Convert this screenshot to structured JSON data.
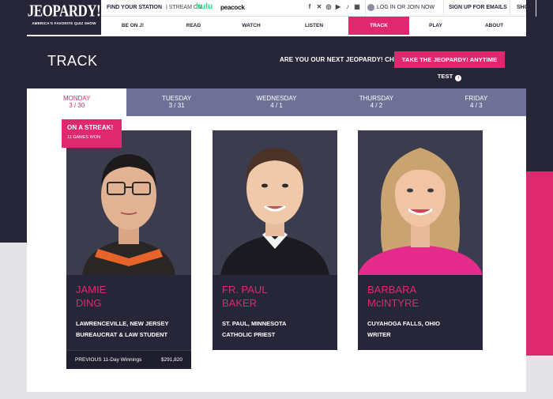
{
  "header": {
    "logo": "JEOPARDY!",
    "tagline": "AMERICA'S FAVORITE QUIZ SHOW",
    "find_station": "FIND YOUR STATION",
    "stream_on": "| STREAM ON",
    "hulu": "hulu",
    "peacock": "peacock",
    "login": "LOG IN OR JOIN NOW",
    "signup": "SIGN UP FOR EMAILS",
    "shop": "SHOP",
    "nav": [
      {
        "label": "BE ON J!"
      },
      {
        "label": "READ"
      },
      {
        "label": "WATCH"
      },
      {
        "label": "LISTEN"
      },
      {
        "label": "TRACK"
      },
      {
        "label": "PLAY"
      },
      {
        "label": "ABOUT"
      }
    ]
  },
  "page": {
    "title": "TRACK",
    "champion_question": "ARE YOU OUR NEXT JEOPARDY! CHAMPION?",
    "test_button": "TAKE THE JEOPARDY! ANYTIME TEST"
  },
  "days": [
    {
      "day": "MONDAY",
      "date": "3 / 30"
    },
    {
      "day": "TUESDAY",
      "date": "3 / 31"
    },
    {
      "day": "WEDNESDAY",
      "date": "4 / 1"
    },
    {
      "day": "THURSDAY",
      "date": "4 / 2"
    },
    {
      "day": "FRIDAY",
      "date": "4 / 3"
    }
  ],
  "streak": {
    "title": "ON A STREAK!",
    "subtitle": "11 GAMES WON"
  },
  "contestants": [
    {
      "name_line1": "JAMIE",
      "name_line2": "DING",
      "location": "LAWRENCEVILLE, NEW JERSEY",
      "job": "BUREAUCRAT & LAW STUDENT",
      "winnings_label": "PREVIOUS 11-Day Winnings",
      "winnings_value": "$291,820"
    },
    {
      "name_line1": "FR. PAUL",
      "name_line2": "BAKER",
      "location": "ST. PAUL, MINNESOTA",
      "job": "CATHOLIC PRIEST"
    },
    {
      "name_line1": "BARBARA",
      "name_line2": "McINTYRE",
      "location": "CUYAHOGA FALLS, OHIO",
      "job": "WRITER"
    }
  ],
  "colors": {
    "navy": "#262638",
    "pink": "#e0286f",
    "tab_purple": "#6e7096"
  }
}
